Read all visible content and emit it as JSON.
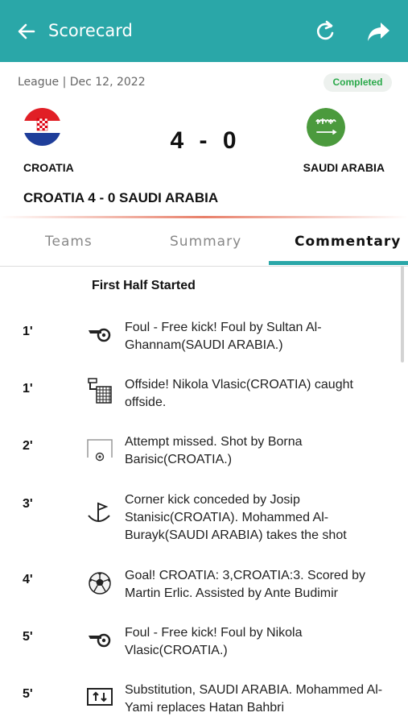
{
  "appbar": {
    "title": "Scorecard"
  },
  "match": {
    "meta": "League | Dec 12, 2022",
    "status": "Completed",
    "home_team": "CROATIA",
    "away_team": "SAUDI ARABIA",
    "home_score": "4",
    "separator": "-",
    "away_score": "0",
    "result": "CROATIA 4 - 0 SAUDI ARABIA"
  },
  "tabs": [
    {
      "label": "Teams",
      "active": false
    },
    {
      "label": "Summary",
      "active": false
    },
    {
      "label": "Commentary",
      "active": true
    }
  ],
  "commentary": {
    "section_title": "First Half Started",
    "events": [
      {
        "minute": "1'",
        "icon": "whistle-icon",
        "lines": [
          "Foul - Free kick! Foul by Sultan Al-",
          "Ghannam(SAUDI ARABIA.)"
        ]
      },
      {
        "minute": "1'",
        "icon": "offside-flag-icon",
        "lines": [
          "Offside! Nikola Vlasic(CROATIA) caught",
          "offside."
        ]
      },
      {
        "minute": "2'",
        "icon": "goal-missed-icon",
        "lines": [
          "Attempt missed. Shot by Borna",
          "Barisic(CROATIA.)"
        ]
      },
      {
        "minute": "3'",
        "icon": "corner-flag-icon",
        "lines": [
          "Corner kick conceded by Josip",
          "Stanisic(CROATIA). Mohammed Al-",
          "Burayk(SAUDI ARABIA) takes the shot"
        ]
      },
      {
        "minute": "4'",
        "icon": "soccer-ball-icon",
        "lines": [
          "Goal! CROATIA: 3,CROATIA:3. Scored by",
          "Martin Erlic. Assisted by Ante Budimir"
        ]
      },
      {
        "minute": "5'",
        "icon": "whistle-icon",
        "lines": [
          "Foul - Free kick! Foul by Nikola",
          "Vlasic(CROATIA.)"
        ]
      },
      {
        "minute": "5'",
        "icon": "substitution-icon",
        "lines": [
          "Substitution, SAUDI ARABIA. Mohammed Al-",
          "Yami replaces Hatan Bahbri"
        ]
      }
    ]
  },
  "colors": {
    "brand": "#2aa7a8",
    "status_green": "#2aa94a",
    "badge_bg": "#edf1ee"
  }
}
